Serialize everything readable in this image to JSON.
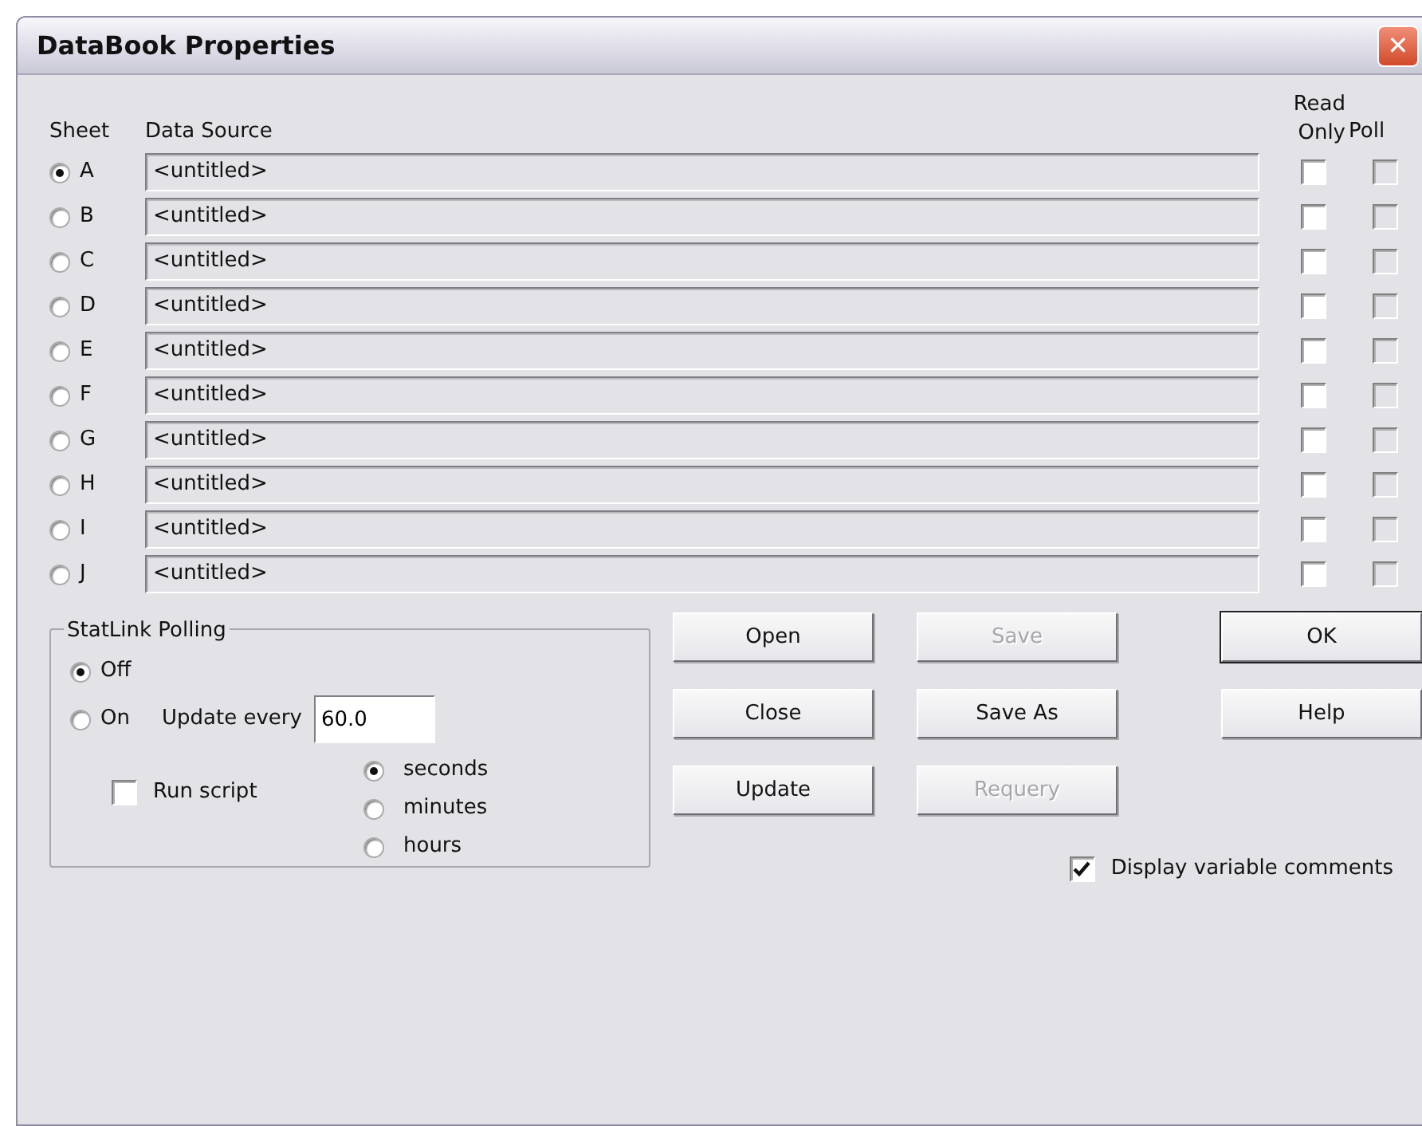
{
  "window": {
    "title": "DataBook Properties",
    "close": "✕"
  },
  "columns": {
    "sheet": "Sheet",
    "data_source": "Data Source",
    "read_only": "Read Only",
    "poll": "Poll"
  },
  "sheets": [
    {
      "letter": "A",
      "selected": true,
      "source": "<untitled>",
      "read_only": false,
      "poll": false,
      "poll_disabled": true
    },
    {
      "letter": "B",
      "selected": false,
      "source": "<untitled>",
      "read_only": false,
      "poll": false,
      "poll_disabled": true
    },
    {
      "letter": "C",
      "selected": false,
      "source": "<untitled>",
      "read_only": false,
      "poll": false,
      "poll_disabled": true
    },
    {
      "letter": "D",
      "selected": false,
      "source": "<untitled>",
      "read_only": false,
      "poll": false,
      "poll_disabled": true
    },
    {
      "letter": "E",
      "selected": false,
      "source": "<untitled>",
      "read_only": false,
      "poll": false,
      "poll_disabled": true
    },
    {
      "letter": "F",
      "selected": false,
      "source": "<untitled>",
      "read_only": false,
      "poll": false,
      "poll_disabled": true
    },
    {
      "letter": "G",
      "selected": false,
      "source": "<untitled>",
      "read_only": false,
      "poll": false,
      "poll_disabled": true
    },
    {
      "letter": "H",
      "selected": false,
      "source": "<untitled>",
      "read_only": false,
      "poll": false,
      "poll_disabled": true
    },
    {
      "letter": "I",
      "selected": false,
      "source": "<untitled>",
      "read_only": false,
      "poll": false,
      "poll_disabled": true
    },
    {
      "letter": "J",
      "selected": false,
      "source": "<untitled>",
      "read_only": false,
      "poll": false,
      "poll_disabled": true
    }
  ],
  "polling": {
    "title": "StatLink Polling",
    "modes": [
      {
        "label": "Off",
        "selected": true
      },
      {
        "label": "On",
        "selected": false
      }
    ],
    "update_label": "Update every",
    "update_value": "60.0",
    "run_script": {
      "label": "Run script",
      "checked": false
    },
    "units": [
      {
        "label": "seconds",
        "selected": true
      },
      {
        "label": "minutes",
        "selected": false
      },
      {
        "label": "hours",
        "selected": false
      }
    ]
  },
  "button_columns": [
    [
      {
        "label": "Open",
        "disabled": false,
        "default": false
      },
      {
        "label": "Close",
        "disabled": false,
        "default": false
      },
      {
        "label": "Update",
        "disabled": false,
        "default": false
      }
    ],
    [
      {
        "label": "Save",
        "disabled": true,
        "default": false
      },
      {
        "label": "Save As",
        "disabled": false,
        "default": false
      },
      {
        "label": "Requery",
        "disabled": true,
        "default": false
      }
    ],
    [
      {
        "label": "OK",
        "disabled": false,
        "default": true
      },
      {
        "label": "Help",
        "disabled": false,
        "default": false
      }
    ]
  ],
  "display_comments": {
    "label": "Display variable comments",
    "checked": true
  }
}
